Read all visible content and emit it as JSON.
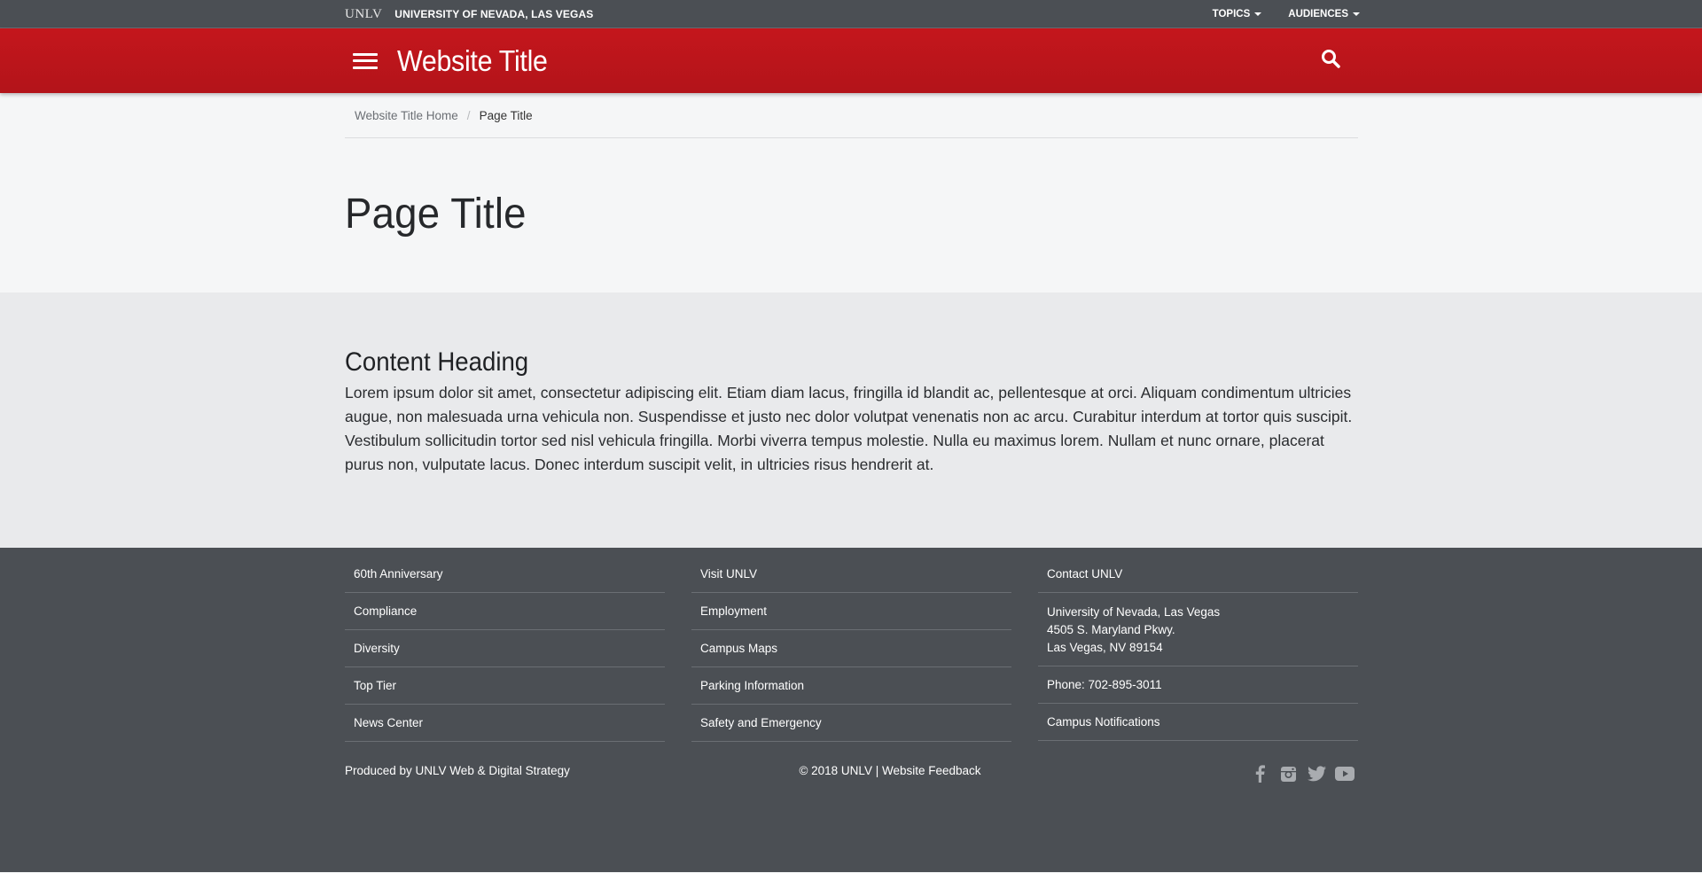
{
  "utility_bar": {
    "logo": "UNLV",
    "university_name": "UNIVERSITY OF NEVADA, LAS VEGAS",
    "nav": [
      {
        "label": "TOPICS"
      },
      {
        "label": "AUDIENCES"
      }
    ]
  },
  "header": {
    "site_title": "Website Title",
    "menu_icon": "hamburger-icon",
    "search_icon": "search-icon",
    "color": "#c4161c"
  },
  "breadcrumb": {
    "home": "Website Title Home",
    "separator": "/",
    "current": "Page Title"
  },
  "page": {
    "title": "Page Title",
    "content_heading": "Content Heading",
    "content_text": "Lorem ipsum dolor sit amet, consectetur adipiscing elit. Etiam diam lacus, fringilla id blandit ac, pellentesque at orci. Aliquam condimentum ultricies augue, non malesuada urna vehicula non. Suspendisse et justo nec dolor volutpat venenatis non ac arcu. Curabitur interdum at tortor quis suscipit. Vestibulum sollicitudin tortor sed nisl vehicula fringilla. Morbi viverra tempus molestie. Nulla eu maximus lorem. Nullam et nunc ornare, placerat purus non, vulputate lacus. Donec interdum suscipit velit, in ultricies risus hendrerit at."
  },
  "footer": {
    "col1": [
      "60th Anniversary",
      "Compliance",
      "Diversity",
      "Top Tier",
      "News Center"
    ],
    "col2": [
      "Visit UNLV",
      "Employment",
      "Campus Maps",
      "Parking Information",
      "Safety and Emergency"
    ],
    "col3": {
      "contact_link": "Contact UNLV",
      "address_line1": "University of Nevada, Las Vegas",
      "address_line2": "4505 S. Maryland Pkwy.",
      "address_line3": "Las Vegas, NV 89154",
      "phone": "Phone: 702-895-3011",
      "notifications": "Campus Notifications"
    },
    "produced_by": "Produced by UNLV Web & Digital Strategy",
    "copyright": "© 2018 UNLV",
    "copyright_separator": " | ",
    "feedback": "Website Feedback",
    "social": [
      "facebook-icon",
      "instagram-icon",
      "twitter-icon",
      "youtube-icon"
    ],
    "background": "#4b4f54"
  }
}
